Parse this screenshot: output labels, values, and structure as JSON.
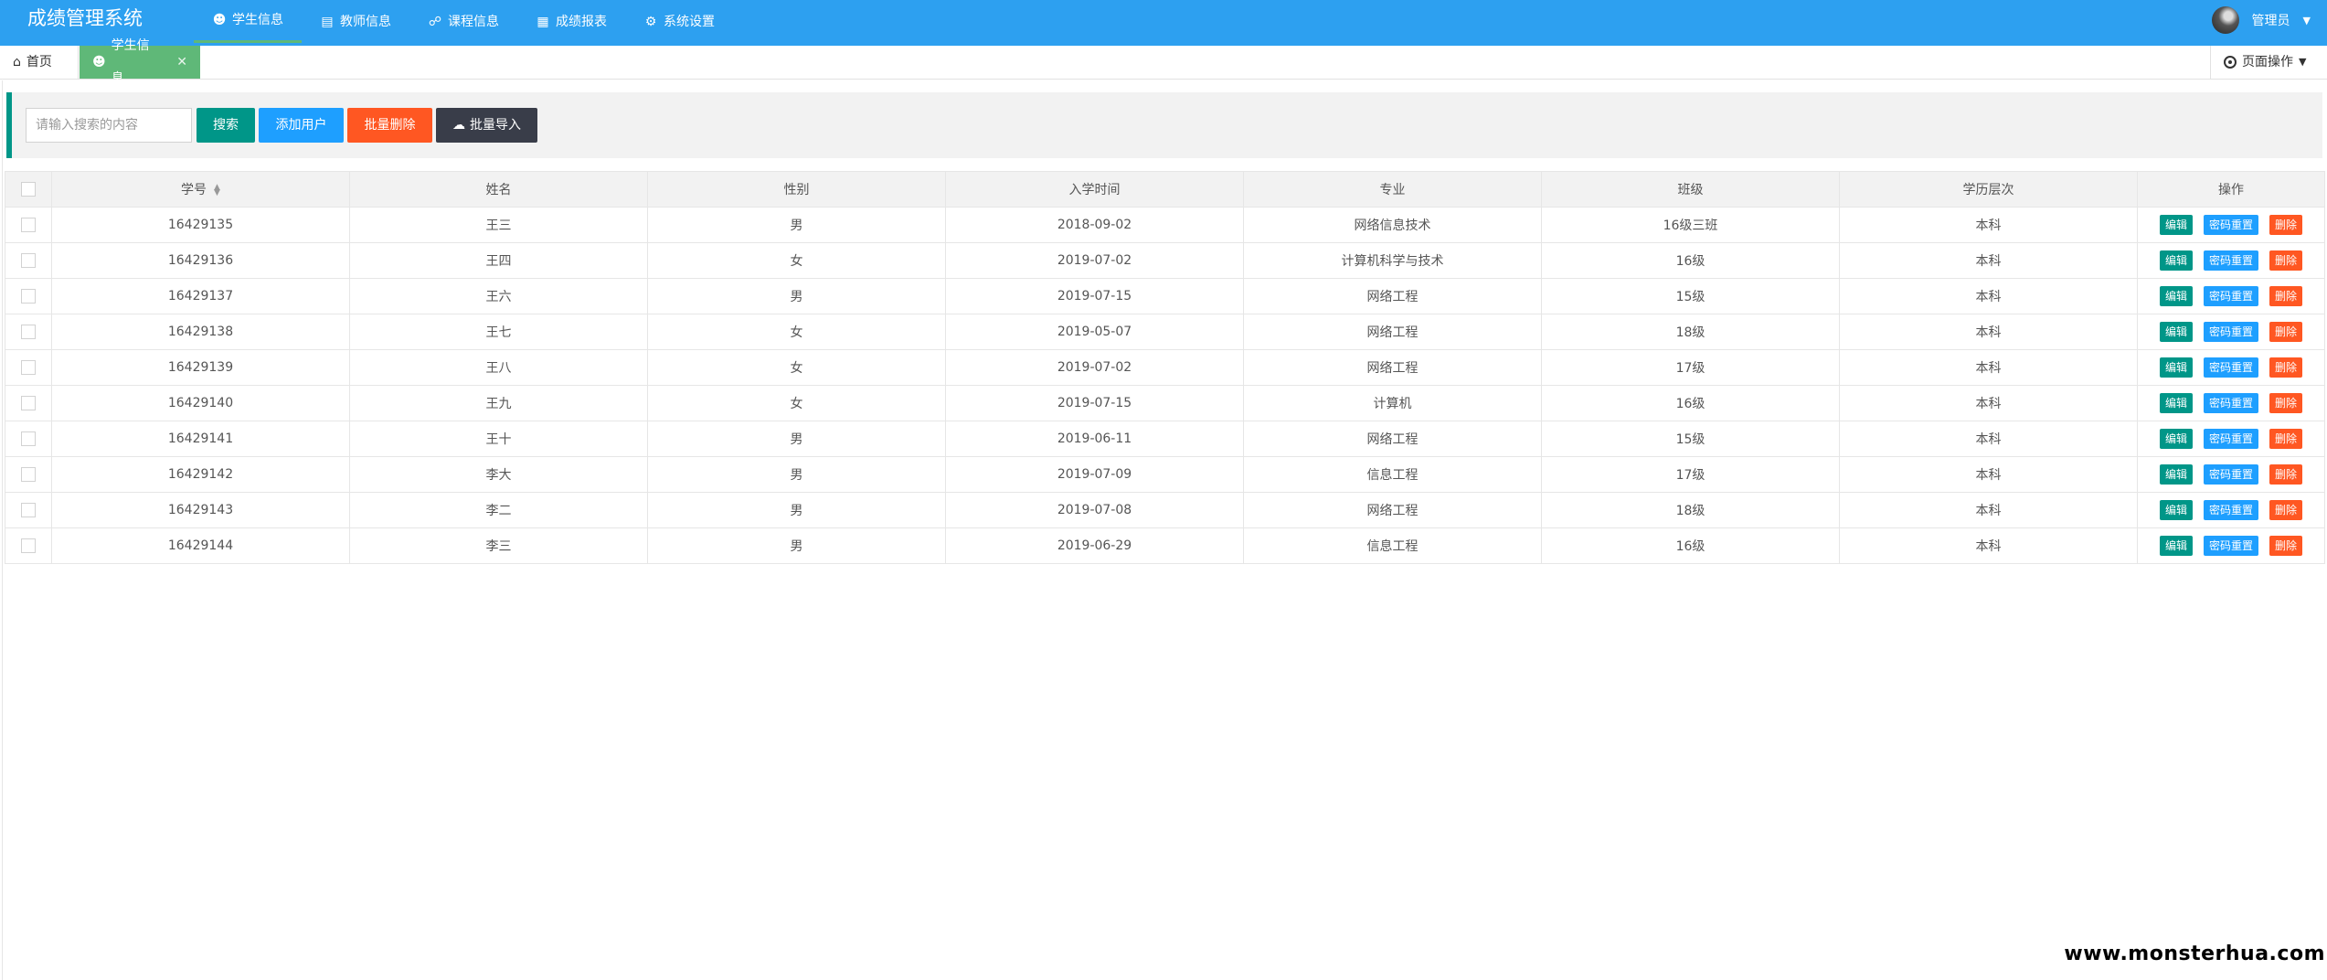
{
  "app": {
    "title": "成绩管理系统"
  },
  "nav": [
    {
      "icon": "users-icon",
      "label": "学生信息",
      "active": true
    },
    {
      "icon": "clipboard-icon",
      "label": "教师信息",
      "active": false
    },
    {
      "icon": "headset-icon",
      "label": "课程信息",
      "active": false
    },
    {
      "icon": "table-icon",
      "label": "成绩报表",
      "active": false
    },
    {
      "icon": "gear-icon",
      "label": "系统设置",
      "active": false
    }
  ],
  "user": {
    "name": "管理员"
  },
  "tabs": {
    "home": "首页",
    "current": "学生信息",
    "page_ops": "页面操作"
  },
  "toolbar": {
    "search_placeholder": "请输入搜索的内容",
    "search": "搜索",
    "add": "添加用户",
    "batch_delete": "批量删除",
    "batch_import": "批量导入"
  },
  "table": {
    "columns": [
      "学号",
      "姓名",
      "性别",
      "入学时间",
      "专业",
      "班级",
      "学历层次",
      "操作"
    ],
    "actions": {
      "edit": "编辑",
      "reset": "密码重置",
      "delete": "删除"
    },
    "rows": [
      [
        "16429135",
        "王三",
        "男",
        "2018-09-02",
        "网络信息技术",
        "16级三班",
        "本科"
      ],
      [
        "16429136",
        "王四",
        "女",
        "2019-07-02",
        "计算机科学与技术",
        "16级",
        "本科"
      ],
      [
        "16429137",
        "王六",
        "男",
        "2019-07-15",
        "网络工程",
        "15级",
        "本科"
      ],
      [
        "16429138",
        "王七",
        "女",
        "2019-05-07",
        "网络工程",
        "18级",
        "本科"
      ],
      [
        "16429139",
        "王八",
        "女",
        "2019-07-02",
        "网络工程",
        "17级",
        "本科"
      ],
      [
        "16429140",
        "王九",
        "女",
        "2019-07-15",
        "计算机",
        "16级",
        "本科"
      ],
      [
        "16429141",
        "王十",
        "男",
        "2019-06-11",
        "网络工程",
        "15级",
        "本科"
      ],
      [
        "16429142",
        "李大",
        "男",
        "2019-07-09",
        "信息工程",
        "17级",
        "本科"
      ],
      [
        "16429143",
        "李二",
        "男",
        "2019-07-08",
        "网络工程",
        "18级",
        "本科"
      ],
      [
        "16429144",
        "李三",
        "男",
        "2019-06-29",
        "信息工程",
        "16级",
        "本科"
      ]
    ]
  },
  "watermark": "www.monsterhua.com"
}
